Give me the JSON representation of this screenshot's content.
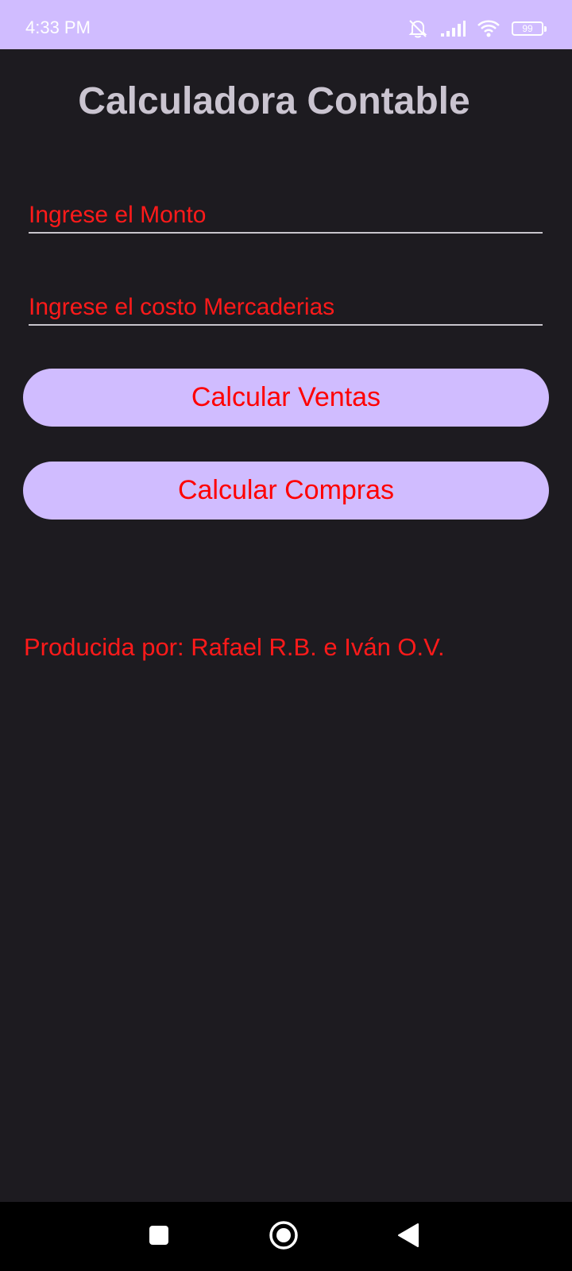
{
  "status_bar": {
    "time": "4:33 PM",
    "battery_level": "99",
    "icons": [
      "mute-icon",
      "signal-icon",
      "wifi-icon",
      "battery-icon"
    ]
  },
  "app": {
    "title": "Calculadora Contable"
  },
  "form": {
    "monto_placeholder": "Ingrese el Monto",
    "monto_value": "",
    "costo_placeholder": "Ingrese el costo Mercaderias",
    "costo_value": ""
  },
  "buttons": {
    "ventas_label": "Calcular Ventas",
    "compras_label": "Calcular Compras"
  },
  "footer": {
    "credit": "Producida por: Rafael R.B. e Iván O.V."
  },
  "navigation": {
    "icons": [
      "recents-icon",
      "home-icon",
      "back-icon"
    ]
  },
  "colors": {
    "status_bar_bg": "#d0bcff",
    "background": "#1d1b20",
    "title": "#cac4d0",
    "accent_text": "#ff0000",
    "button_bg": "#d0bcff",
    "nav_bar_bg": "#000000"
  }
}
